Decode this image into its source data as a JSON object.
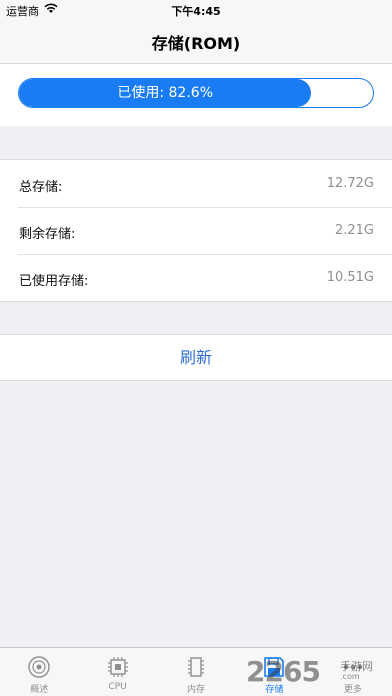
{
  "status_bar": {
    "carrier": "运营商",
    "time": "下午4:45"
  },
  "nav": {
    "title": "存储(ROM)"
  },
  "progress": {
    "label": "已使用: 82.6%",
    "fraction": 0.826,
    "color": "#1a7cf2"
  },
  "info": {
    "rows": [
      {
        "label": "总存储:",
        "value": "12.72G"
      },
      {
        "label": "剩余存储:",
        "value": "2.21G"
      },
      {
        "label": "已使用存储:",
        "value": "10.51G"
      }
    ]
  },
  "refresh": {
    "label": "刷新"
  },
  "tabs": [
    {
      "label": "概述",
      "icon": "overview-icon",
      "active": false
    },
    {
      "label": "CPU",
      "icon": "cpu-icon",
      "active": false
    },
    {
      "label": "内存",
      "icon": "memory-icon",
      "active": false
    },
    {
      "label": "存储",
      "icon": "storage-icon",
      "active": true
    },
    {
      "label": "更多",
      "icon": "more-icon",
      "active": false
    }
  ],
  "watermark": {
    "number": "2265",
    "site": "手游网",
    "url": ".com"
  }
}
